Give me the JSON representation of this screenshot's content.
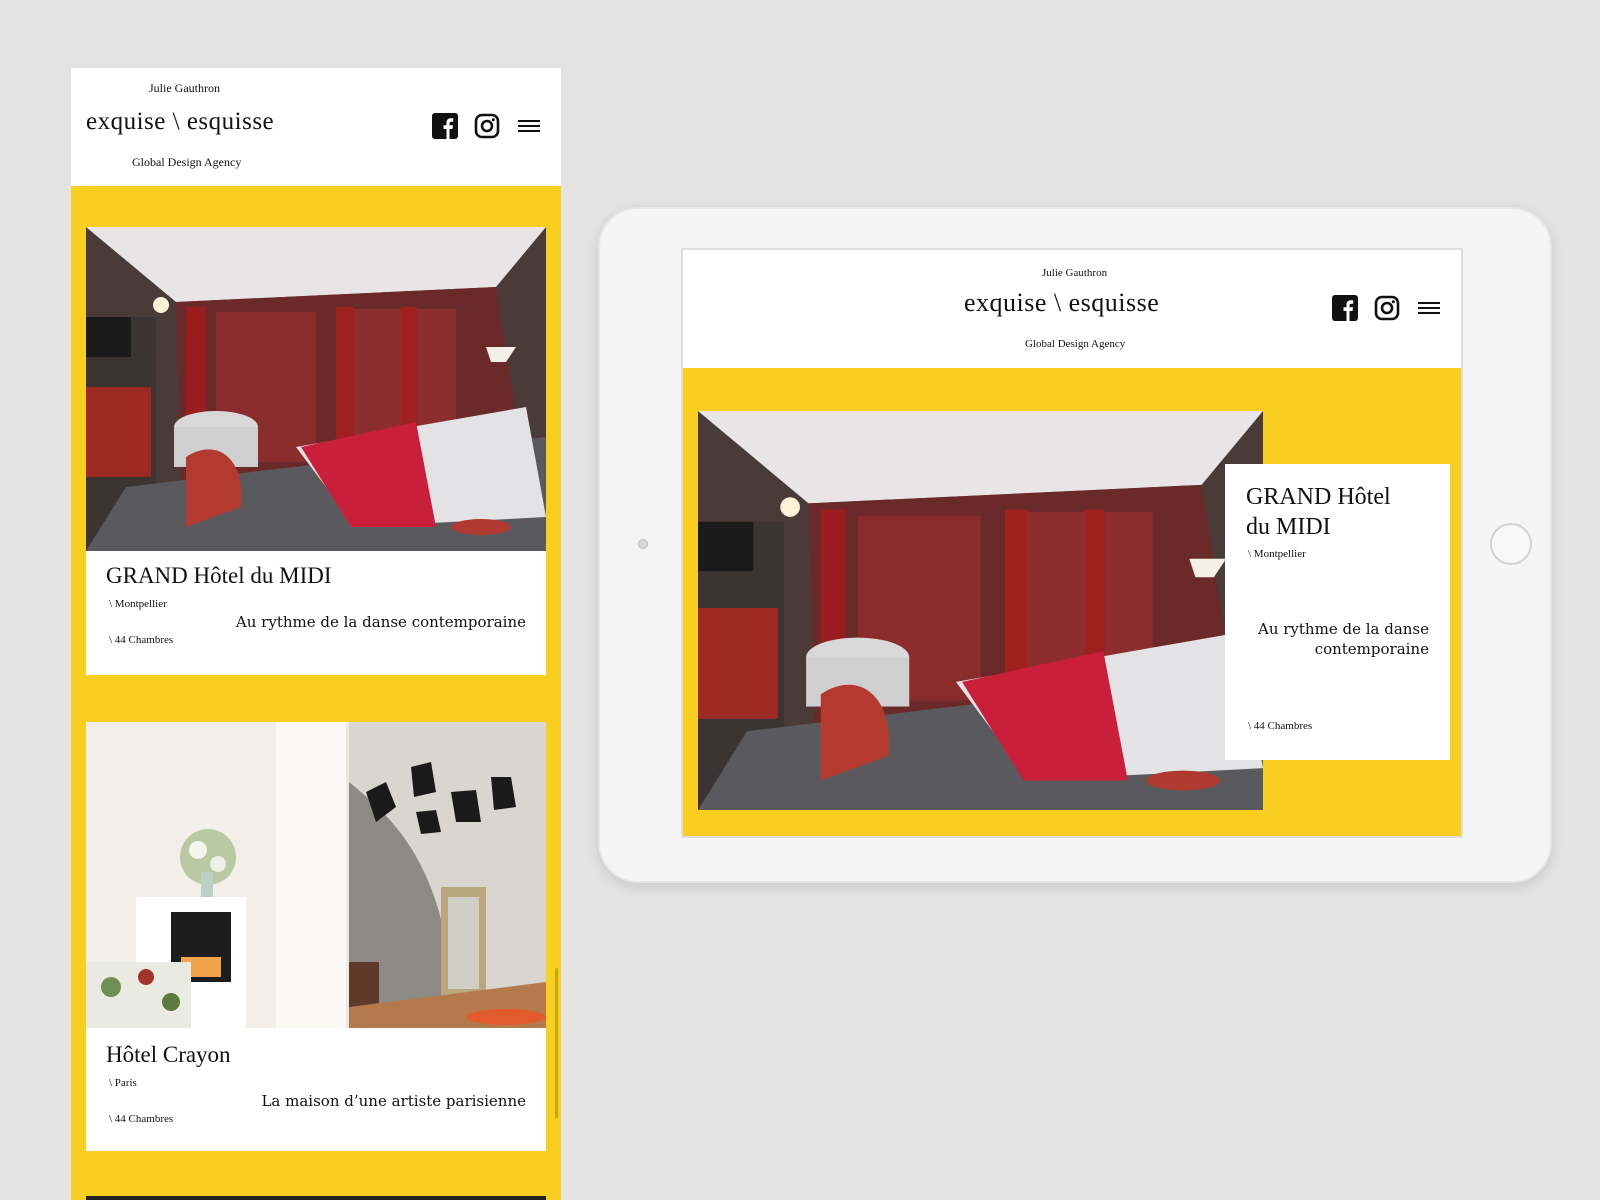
{
  "brand": {
    "top": "Julie Gauthron",
    "logo": "exquise \\ esquisse",
    "sub": "Global Design Agency"
  },
  "icons": [
    "facebook-icon",
    "instagram-icon",
    "menu-icon"
  ],
  "colors": {
    "accent": "#f8cf1f",
    "text": "#111111",
    "background": "#e3e3e3"
  },
  "phone": {
    "cards": [
      {
        "title": "GRAND Hôtel du MIDI",
        "city": "\\ Montpellier",
        "description": "Au rythme de la danse contemporaine",
        "rooms": "\\ 44 Chambres"
      },
      {
        "title": "Hôtel Crayon",
        "city": "\\ Paris",
        "description": "La maison d’une artiste parisienne",
        "rooms": "\\ 44 Chambres"
      }
    ]
  },
  "tablet": {
    "card": {
      "title_line1": "GRAND Hôtel",
      "title_line2": "du MIDI",
      "city": "\\ Montpellier",
      "description": "Au rythme de la danse contemporaine",
      "rooms": "\\ 44 Chambres"
    }
  }
}
